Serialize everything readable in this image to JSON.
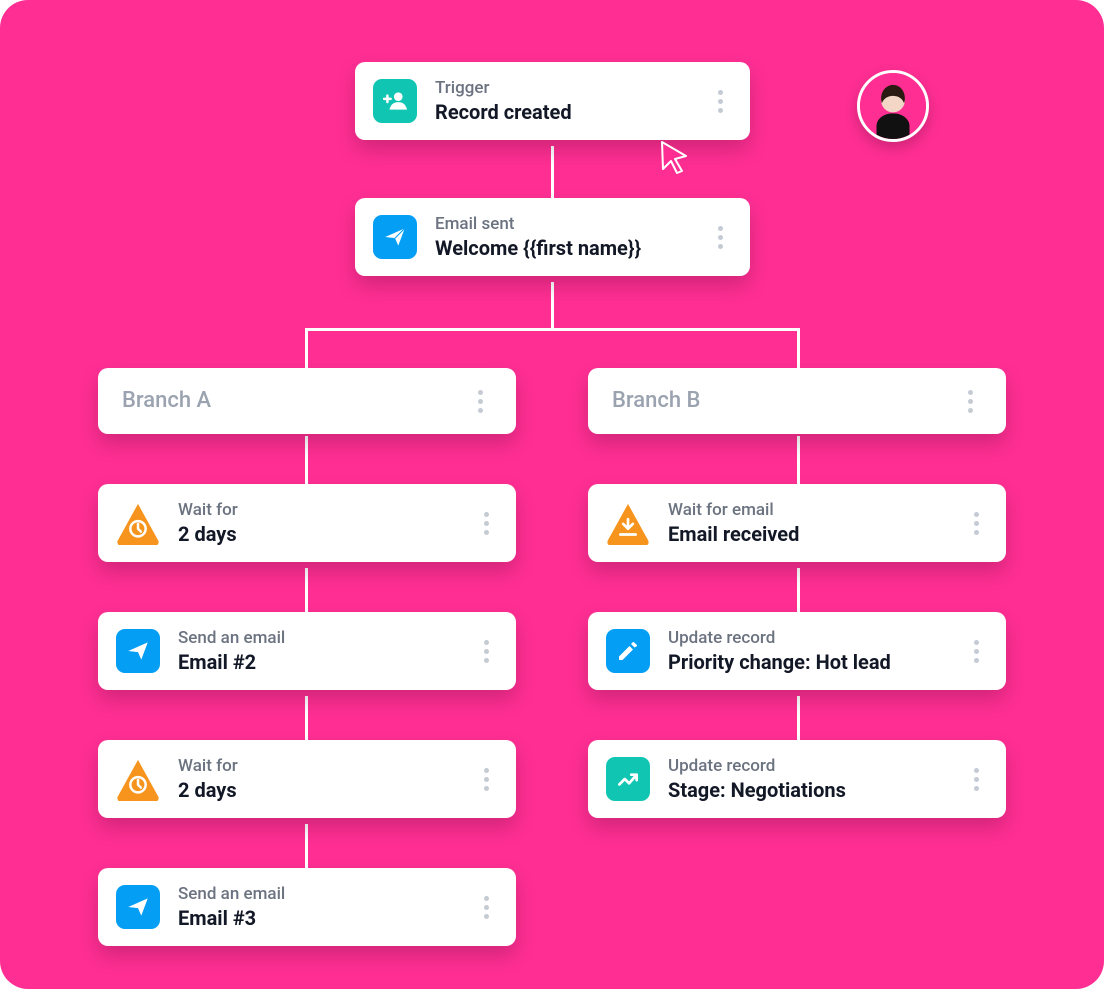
{
  "avatar": {
    "present": true
  },
  "trigger": {
    "label": "Trigger",
    "title": "Record created",
    "icon": "person-add"
  },
  "step_email": {
    "label": "Email sent",
    "title": "Welcome {{first name}}",
    "icon": "send"
  },
  "branches": {
    "a": {
      "header": "Branch A",
      "steps": [
        {
          "label": "Wait for",
          "title": "2 days",
          "icon": "wait-clock"
        },
        {
          "label": "Send an email",
          "title": "Email #2",
          "icon": "send"
        },
        {
          "label": "Wait for",
          "title": "2 days",
          "icon": "wait-clock"
        },
        {
          "label": "Send an email",
          "title": "Email #3",
          "icon": "send"
        }
      ]
    },
    "b": {
      "header": "Branch B",
      "steps": [
        {
          "label": "Wait for email",
          "title": "Email received",
          "icon": "wait-download"
        },
        {
          "label": "Update record",
          "title": "Priority change: Hot lead",
          "icon": "edit"
        },
        {
          "label": "Update record",
          "title": "Stage: Negotiations",
          "icon": "trend"
        }
      ]
    }
  },
  "colors": {
    "bg": "#FF2E93",
    "blue": "#049EF4",
    "teal": "#11C5B3",
    "orange": "#F7941E"
  }
}
